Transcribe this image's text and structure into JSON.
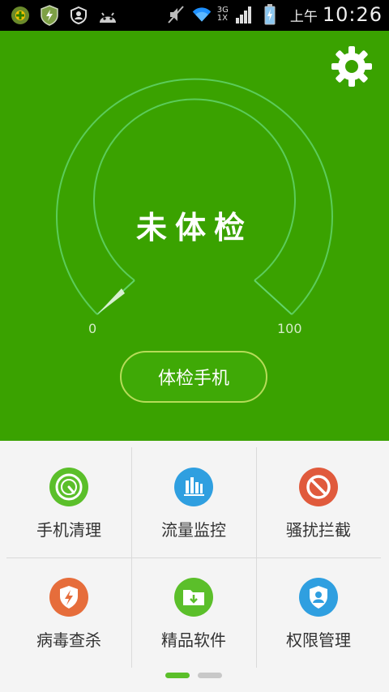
{
  "statusbar": {
    "network_top": "3G",
    "network_bottom": "1X",
    "ampm": "上午",
    "time": "10:26"
  },
  "gauge": {
    "status": "未体检",
    "scale_min": "0",
    "scale_max": "100"
  },
  "action": {
    "check_button": "体检手机"
  },
  "features": [
    {
      "label": "手机清理",
      "icon": "cleanup-icon",
      "color": "#5bbf2a"
    },
    {
      "label": "流量监控",
      "icon": "bar-chart-icon",
      "color": "#2f9fe0"
    },
    {
      "label": "骚扰拦截",
      "icon": "block-icon",
      "color": "#e05a3c"
    },
    {
      "label": "病毒查杀",
      "icon": "virus-shield-icon",
      "color": "#e66d3b"
    },
    {
      "label": "精品软件",
      "icon": "download-folder-icon",
      "color": "#5bbf2a"
    },
    {
      "label": "权限管理",
      "icon": "user-shield-icon",
      "color": "#2f9fe0"
    }
  ],
  "pager": {
    "pages": 2,
    "active": 1
  },
  "colors": {
    "brand_green": "#3aa200",
    "dot_active": "#5bbf2a",
    "dot_inactive": "#c8c8c8"
  }
}
